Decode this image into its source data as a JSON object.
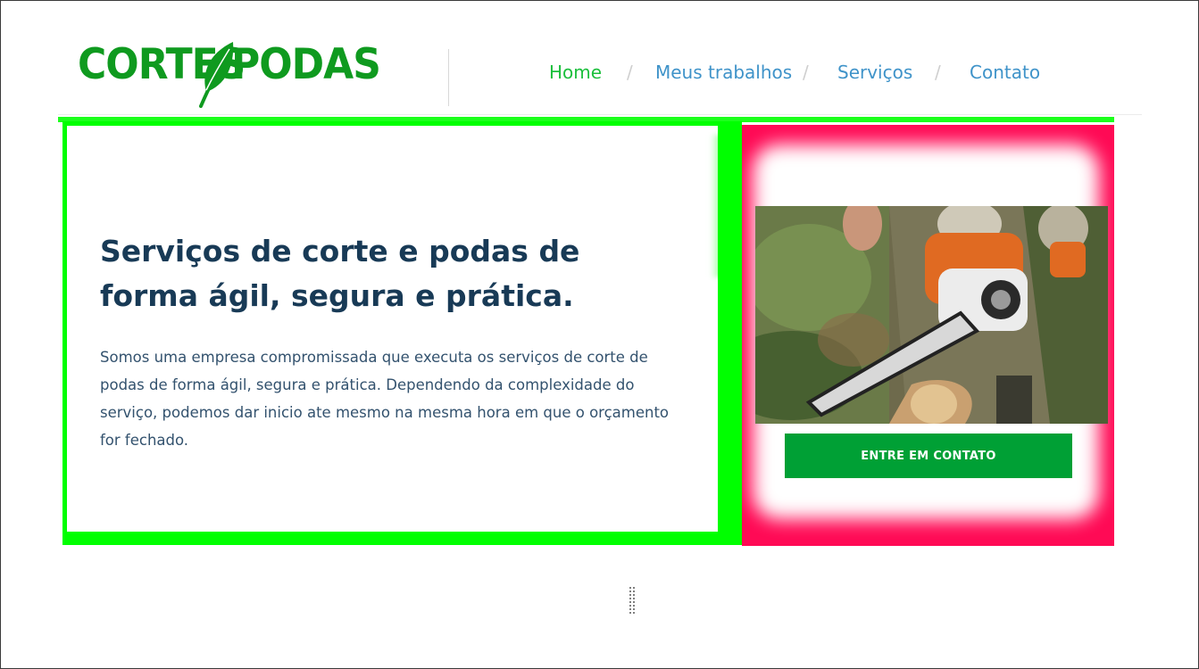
{
  "logo": {
    "left_text": "CORTES",
    "right_text": "PODAS",
    "color": "#0f9a1f"
  },
  "nav": {
    "items": [
      {
        "label": "Home",
        "active": true
      },
      {
        "label": "Meus trabalhos",
        "active": false
      },
      {
        "label": "Serviços",
        "active": false
      },
      {
        "label": "Contato",
        "active": false
      }
    ],
    "separator": "/",
    "active_color": "#1bbf3c",
    "color": "#3f93c9"
  },
  "hero": {
    "title_line1": "Serviços de corte e podas de",
    "title_line2": "forma ágil, segura e prática.",
    "text": "Somos uma empresa compromissada que executa os serviços de corte de podas de forma ágil, segura e prática. Dependendo da complexidade do serviço, podemos dar inicio ate mesmo na mesma hora em que o orçamento for fechado."
  },
  "side_card": {
    "image_icon": "chainsaw-photo",
    "button_label": "ENTRE EM CONTATO",
    "button_color": "#00a035",
    "frame_color": "#ff0a55"
  },
  "colors": {
    "outline_green": "#00ff00",
    "title": "#183a56",
    "body_text": "#33526e"
  }
}
